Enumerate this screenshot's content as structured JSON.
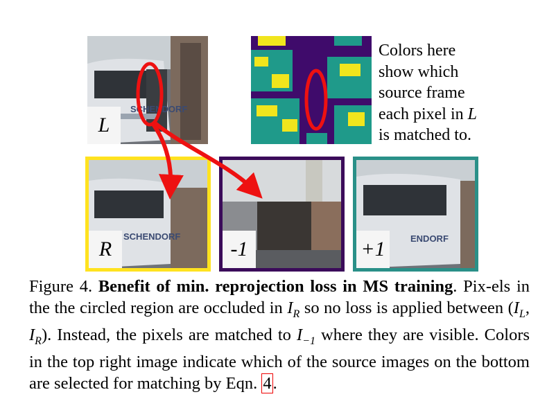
{
  "images": {
    "L": {
      "label": "L"
    },
    "R": {
      "label": "R",
      "border_color": "#ffe21f"
    },
    "minus1": {
      "label": "-1",
      "border_color": "#3b0b5a"
    },
    "plus1": {
      "label": "+1",
      "border_color": "#2a9088"
    }
  },
  "side_note": {
    "lines": [
      "Colors here",
      "show which",
      "source frame",
      "each pixel in",
      "is matched to."
    ],
    "italic_L": "L"
  },
  "caption": {
    "prefix": "Figure 4. ",
    "bold": "Benefit of min. reprojection loss in MS training",
    "text_1": ". Pix-els in the the circled region are occluded in ",
    "IR": "I",
    "IR_sub": "R",
    "text_2": " so no loss is applied between (",
    "IL2": "I",
    "IL2_sub": "L",
    "comma": ", ",
    "IR2": "I",
    "IR2_sub": "R",
    "text_3": "). Instead, the pixels are matched to ",
    "Im1": "I",
    "Im1_sub": "−1",
    "text_4": " where they are visible. Colors in the top right image indicate which of the source images on the bottom are selected for matching by Eqn. ",
    "ref": "4",
    "end": "."
  },
  "colors": {
    "arrow": "#ee1111",
    "map_purple": "#3f0b6b",
    "map_teal": "#1f9a8a",
    "map_yellow": "#f1e51d"
  }
}
